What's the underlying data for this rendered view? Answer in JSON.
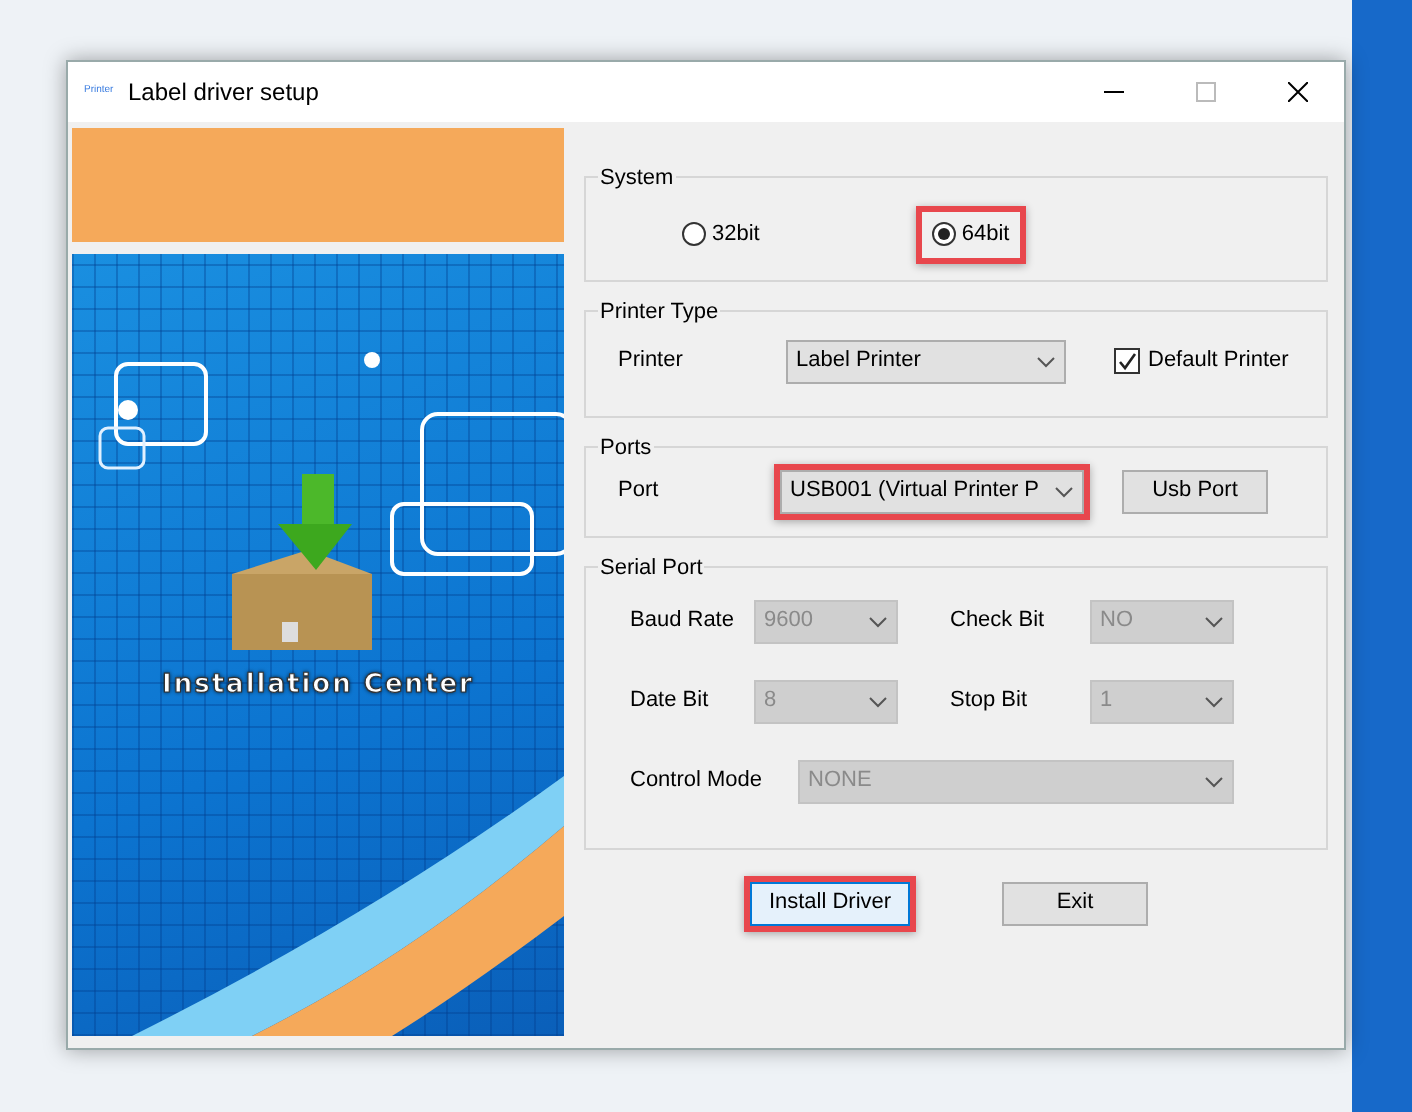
{
  "window": {
    "icon_text": "Printer",
    "title": "Label driver setup"
  },
  "banner": {
    "caption": "Installation Center"
  },
  "system": {
    "title": "System",
    "options": [
      {
        "label": "32bit",
        "selected": false,
        "highlighted": false
      },
      {
        "label": "64bit",
        "selected": true,
        "highlighted": true
      }
    ]
  },
  "printer_type": {
    "title": "Printer Type",
    "label": "Printer",
    "value": "Label Printer",
    "default_printer": {
      "label": "Default Printer",
      "checked": true
    }
  },
  "ports": {
    "title": "Ports",
    "label": "Port",
    "value": "USB001 (Virtual Printer P",
    "highlighted": true,
    "button": "Usb Port"
  },
  "serial_port": {
    "title": "Serial Port",
    "fields": [
      {
        "kind": "half",
        "label": "Baud Rate",
        "value": "9600",
        "disabled": true
      },
      {
        "kind": "half",
        "label": "Check Bit",
        "value": "NO",
        "disabled": true
      },
      {
        "kind": "half",
        "label": "Date Bit",
        "value": "8",
        "disabled": true
      },
      {
        "kind": "half",
        "label": "Stop Bit",
        "value": "1",
        "disabled": true
      },
      {
        "kind": "wide",
        "label": "Control Mode",
        "value": "NONE",
        "disabled": true
      }
    ]
  },
  "buttons": [
    {
      "label": "Install Driver",
      "focused": true,
      "highlighted": true
    },
    {
      "label": "Exit",
      "focused": false,
      "highlighted": false
    }
  ]
}
